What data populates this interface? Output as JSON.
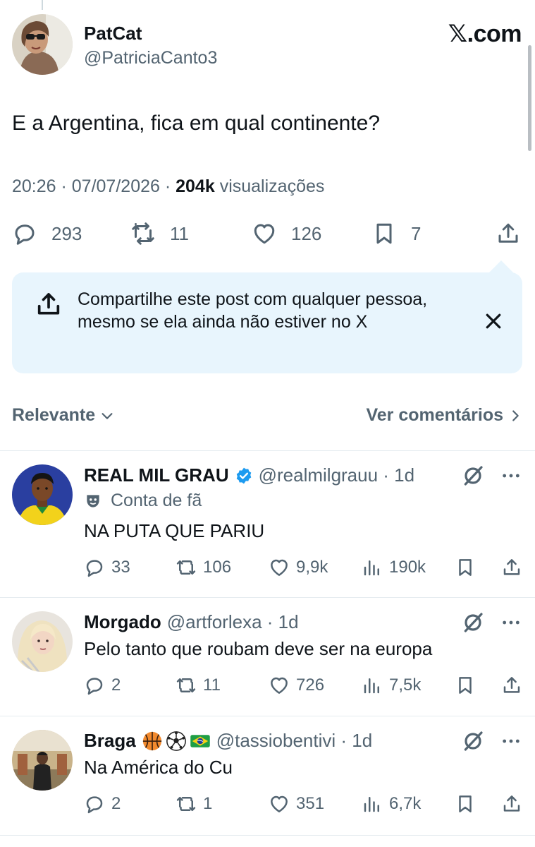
{
  "post": {
    "author_name": "PatCat",
    "author_handle": "@PatriciaCanto3",
    "site_label": "com",
    "text": "E a Argentina, fica em qual continente?",
    "time": "20:26 · 07/07/2026 · ",
    "views_count": "204k",
    "views_label": " visualizações",
    "actions": {
      "replies": "293",
      "reposts": "11",
      "likes": "126",
      "bookmarks": "7"
    }
  },
  "share_tip": {
    "text": "Compartilhe este post com qualquer pessoa, mesmo se ela ainda não estiver no X"
  },
  "sort_bar": {
    "left_label": "Relevante",
    "right_label": "Ver comentários"
  },
  "replies": [
    {
      "name": "REAL MIL GRAU",
      "verified": true,
      "handle": "@realmilgrauu · 1d",
      "fan_label": "Conta de fã",
      "text": "NA PUTA QUE PARIU",
      "replies": "33",
      "reposts": "106",
      "likes": "9,9k",
      "views": "190k"
    },
    {
      "name": "Morgado",
      "handle": "@artforlexa · 1d",
      "text": "Pelo tanto que roubam deve ser na europa",
      "replies": "2",
      "reposts": "11",
      "likes": "726",
      "views": "7,5k"
    },
    {
      "name": "Braga",
      "emojis": [
        "basketball-emoji",
        "soccer-ball-emoji",
        "brazil-flag-emoji"
      ],
      "handle": "@tassiobentivi · 1d",
      "text": "Na América do Cu",
      "replies": "2",
      "reposts": "1",
      "likes": "351",
      "views": "6,7k"
    }
  ],
  "colors": {
    "text_primary": "#0f1419",
    "text_secondary": "#536471",
    "verified_blue": "#1d9bf0",
    "tip_background": "#e8f5fd",
    "divider": "#e6ecf0"
  }
}
